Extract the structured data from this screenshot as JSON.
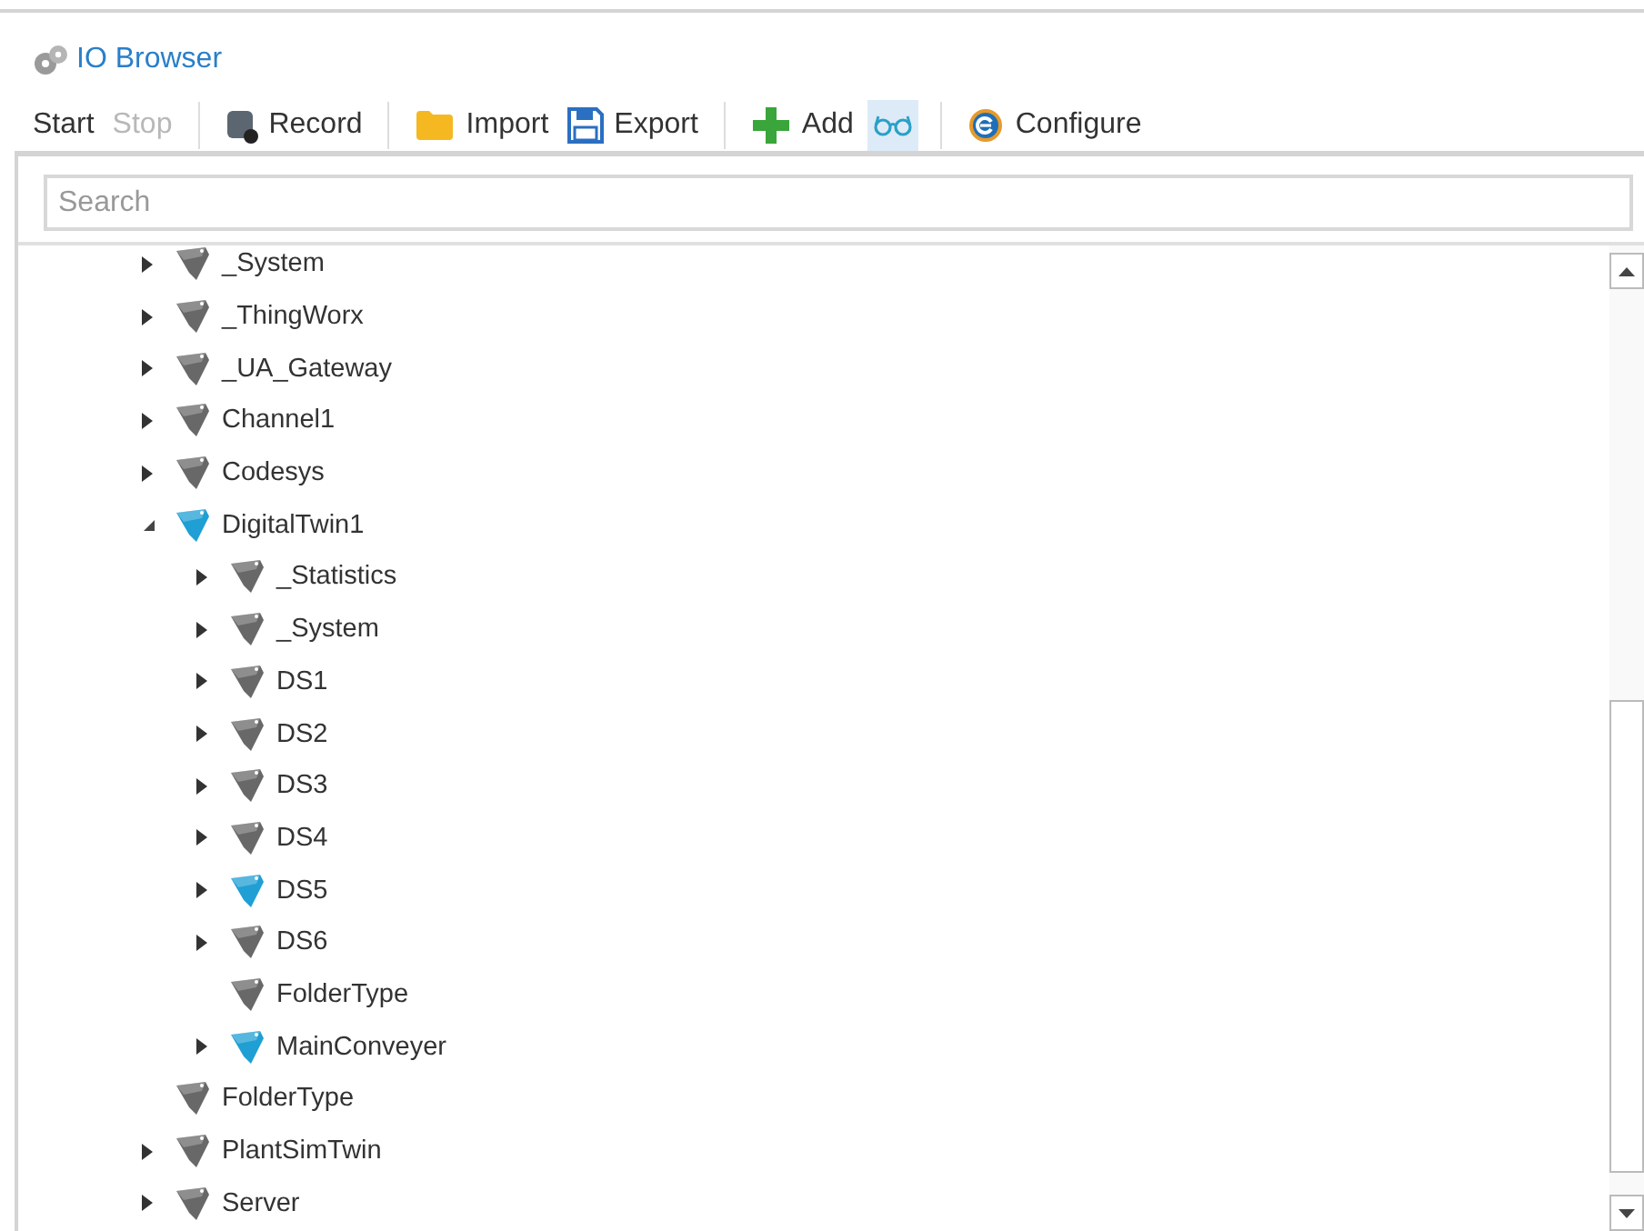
{
  "header": {
    "title": "IO Browser"
  },
  "toolbar": [
    {
      "kind": "text",
      "label": "Start",
      "disabled": false
    },
    {
      "kind": "text",
      "label": "Stop",
      "disabled": true
    },
    {
      "kind": "separator"
    },
    {
      "kind": "record",
      "label": "Record",
      "disabled": false
    },
    {
      "kind": "separator"
    },
    {
      "kind": "import",
      "label": "Import",
      "disabled": false
    },
    {
      "kind": "export",
      "label": "Export",
      "disabled": false
    },
    {
      "kind": "separator"
    },
    {
      "kind": "add",
      "label": "Add",
      "disabled": false
    },
    {
      "kind": "glasses",
      "on": true
    },
    {
      "kind": "separator"
    },
    {
      "kind": "configure",
      "label": "Configure",
      "disabled": false
    }
  ],
  "search": {
    "placeholder": "Search"
  },
  "tree": [
    {
      "label": "_System",
      "expandable": true,
      "expanded": false,
      "color": "#686868"
    },
    {
      "label": "_ThingWorx",
      "expandable": true,
      "expanded": false,
      "color": "#686868"
    },
    {
      "label": "_UA_Gateway",
      "expandable": true,
      "expanded": false,
      "color": "#686868"
    },
    {
      "label": "Channel1",
      "expandable": true,
      "expanded": false,
      "color": "#686868"
    },
    {
      "label": "Codesys",
      "expandable": true,
      "expanded": false,
      "color": "#686868"
    },
    {
      "label": "DigitalTwin1",
      "expandable": true,
      "expanded": true,
      "color": "#1f9fd4",
      "children": [
        {
          "label": "_Statistics",
          "expandable": true,
          "expanded": false,
          "color": "#686868"
        },
        {
          "label": "_System",
          "expandable": true,
          "expanded": false,
          "color": "#686868"
        },
        {
          "label": "DS1",
          "expandable": true,
          "expanded": false,
          "color": "#686868"
        },
        {
          "label": "DS2",
          "expandable": true,
          "expanded": false,
          "color": "#686868"
        },
        {
          "label": "DS3",
          "expandable": true,
          "expanded": false,
          "color": "#686868"
        },
        {
          "label": "DS4",
          "expandable": true,
          "expanded": false,
          "color": "#686868"
        },
        {
          "label": "DS5",
          "expandable": true,
          "expanded": false,
          "color": "#1f9fd4"
        },
        {
          "label": "DS6",
          "expandable": true,
          "expanded": false,
          "color": "#686868"
        },
        {
          "label": "FolderType",
          "expandable": false,
          "expanded": false,
          "color": "#686868"
        },
        {
          "label": "MainConveyer",
          "expandable": true,
          "expanded": false,
          "color": "#1f9fd4"
        }
      ]
    },
    {
      "label": "FolderType",
      "expandable": false,
      "expanded": false,
      "color": "#686868"
    },
    {
      "label": "PlantSimTwin",
      "expandable": true,
      "expanded": false,
      "color": "#686868"
    },
    {
      "label": "Server",
      "expandable": true,
      "expanded": false,
      "color": "#686868"
    }
  ]
}
